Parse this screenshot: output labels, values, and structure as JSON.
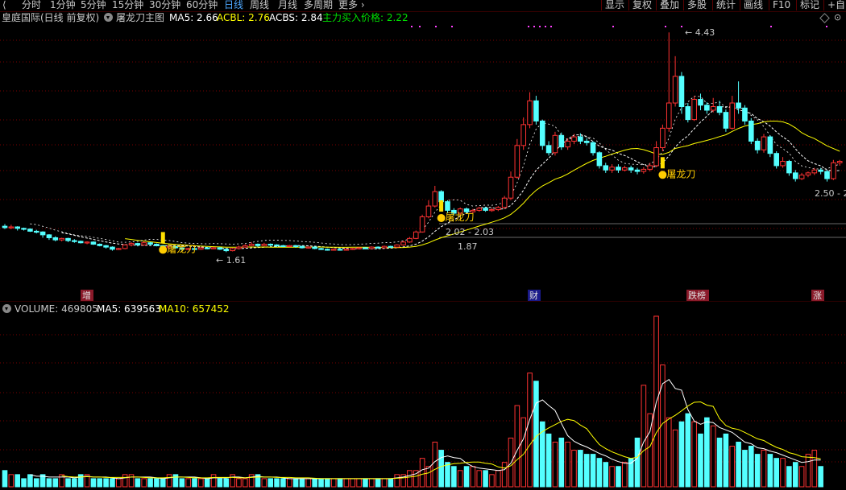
{
  "period_tabs": [
    "分时",
    "1分钟",
    "5分钟",
    "15分钟",
    "30分钟",
    "60分钟",
    "日线",
    "周线",
    "月线",
    "多周期",
    "更多"
  ],
  "active_tab": "日线",
  "right_buttons": [
    "显示",
    "复权",
    "叠加",
    "多股",
    "统计",
    "画线",
    "F10",
    "标记",
    "+自"
  ],
  "stock_title": "皇庭国际(日线 前复权)",
  "indicator_name": "屠龙刀主图",
  "ma5_label": "MA5: 2.66",
  "acbl_label": "ACBL: 2.76",
  "acbs_label": "ACBS: 2.84",
  "buy_price_label": "主力买入价格: 2.22",
  "price_annotations": {
    "high": "4.43",
    "low": "1.61",
    "level1": "2.02 - 2.03",
    "level2": "1.87",
    "right": "2.50 - 2"
  },
  "signal_text": "屠龙刀",
  "events": [
    "增",
    "财",
    "跌榜",
    "涨"
  ],
  "volume_label": "VOLUME: 469805",
  "vol_ma5_label": "MA5: 639563",
  "vol_ma10_label": "MA10: 657452",
  "colors": {
    "up": "#ff3232",
    "down": "#54ffff",
    "ma_white": "#ffffff",
    "ma_yellow": "#ffff00",
    "buy_green": "#00e000",
    "active_tab": "#4ea8ff",
    "grid": "#7a0000",
    "magenta_dots": "#ff40ff"
  },
  "chart_data": {
    "type": "candlestick",
    "price_high": 4.43,
    "price_low": 1.61,
    "candles": [
      [
        1.74,
        1.72,
        1.77,
        1.7
      ],
      [
        1.72,
        1.73,
        1.76,
        1.7
      ],
      [
        1.73,
        1.71,
        1.74,
        1.68
      ],
      [
        1.71,
        1.7,
        1.72,
        1.68
      ],
      [
        1.7,
        1.67,
        1.71,
        1.66
      ],
      [
        1.67,
        1.66,
        1.69,
        1.64
      ],
      [
        1.66,
        1.62,
        1.67,
        1.58
      ],
      [
        1.62,
        1.58,
        1.63,
        1.55
      ],
      [
        1.58,
        1.55,
        1.6,
        1.53
      ],
      [
        1.55,
        1.57,
        1.58,
        1.53
      ],
      [
        1.57,
        1.54,
        1.58,
        1.52
      ],
      [
        1.54,
        1.53,
        1.56,
        1.51
      ],
      [
        1.53,
        1.51,
        1.54,
        1.5
      ],
      [
        1.51,
        1.52,
        1.53,
        1.49
      ],
      [
        1.52,
        1.49,
        1.53,
        1.48
      ],
      [
        1.49,
        1.47,
        1.5,
        1.46
      ],
      [
        1.47,
        1.45,
        1.48,
        1.43
      ],
      [
        1.45,
        1.42,
        1.46,
        1.4
      ],
      [
        1.42,
        1.43,
        1.44,
        1.41
      ],
      [
        1.43,
        1.48,
        1.49,
        1.42
      ],
      [
        1.48,
        1.5,
        1.52,
        1.46
      ],
      [
        1.5,
        1.48,
        1.51,
        1.46
      ],
      [
        1.48,
        1.51,
        1.53,
        1.47
      ],
      [
        1.51,
        1.49,
        1.52,
        1.47
      ],
      [
        1.49,
        1.47,
        1.5,
        1.46
      ],
      [
        1.47,
        1.44,
        1.48,
        1.43
      ],
      [
        1.44,
        1.46,
        1.47,
        1.42
      ],
      [
        1.46,
        1.44,
        1.47,
        1.43
      ],
      [
        1.44,
        1.42,
        1.45,
        1.4
      ],
      [
        1.42,
        1.43,
        1.44,
        1.41
      ],
      [
        1.43,
        1.42,
        1.44,
        1.41
      ],
      [
        1.42,
        1.44,
        1.45,
        1.41
      ],
      [
        1.44,
        1.43,
        1.45,
        1.42
      ],
      [
        1.43,
        1.44,
        1.45,
        1.42
      ],
      [
        1.44,
        1.42,
        1.45,
        1.41
      ],
      [
        1.42,
        1.4,
        1.43,
        1.38
      ],
      [
        1.4,
        1.43,
        1.44,
        1.39
      ],
      [
        1.43,
        1.45,
        1.47,
        1.42
      ],
      [
        1.45,
        1.47,
        1.49,
        1.44
      ],
      [
        1.47,
        1.49,
        1.52,
        1.46
      ],
      [
        1.49,
        1.47,
        1.5,
        1.45
      ],
      [
        1.47,
        1.49,
        1.51,
        1.46
      ],
      [
        1.49,
        1.48,
        1.5,
        1.46
      ],
      [
        1.48,
        1.47,
        1.49,
        1.45
      ],
      [
        1.47,
        1.46,
        1.48,
        1.45
      ],
      [
        1.46,
        1.47,
        1.48,
        1.45
      ],
      [
        1.47,
        1.46,
        1.48,
        1.44
      ],
      [
        1.46,
        1.44,
        1.47,
        1.43
      ],
      [
        1.44,
        1.45,
        1.46,
        1.43
      ],
      [
        1.45,
        1.43,
        1.46,
        1.42
      ],
      [
        1.43,
        1.42,
        1.44,
        1.41
      ],
      [
        1.42,
        1.41,
        1.43,
        1.4
      ],
      [
        1.41,
        1.42,
        1.43,
        1.4
      ],
      [
        1.42,
        1.41,
        1.43,
        1.4
      ],
      [
        1.41,
        1.42,
        1.43,
        1.4
      ],
      [
        1.42,
        1.43,
        1.44,
        1.41
      ],
      [
        1.43,
        1.44,
        1.45,
        1.42
      ],
      [
        1.44,
        1.43,
        1.45,
        1.42
      ],
      [
        1.43,
        1.45,
        1.46,
        1.42
      ],
      [
        1.45,
        1.44,
        1.46,
        1.43
      ],
      [
        1.44,
        1.46,
        1.47,
        1.43
      ],
      [
        1.46,
        1.45,
        1.47,
        1.44
      ],
      [
        1.45,
        1.48,
        1.49,
        1.44
      ],
      [
        1.48,
        1.52,
        1.54,
        1.47
      ],
      [
        1.52,
        1.57,
        1.59,
        1.51
      ],
      [
        1.57,
        1.66,
        1.68,
        1.56
      ],
      [
        1.66,
        1.87,
        1.9,
        1.65
      ],
      [
        1.87,
        2.02,
        2.1,
        1.85
      ],
      [
        2.02,
        2.22,
        2.3,
        2.0
      ],
      [
        2.22,
        2.08,
        2.24,
        2.04
      ],
      [
        2.08,
        1.96,
        2.1,
        1.92
      ],
      [
        1.96,
        1.92,
        1.99,
        1.89
      ],
      [
        1.92,
        1.98,
        2.0,
        1.9
      ],
      [
        1.98,
        1.94,
        2.0,
        1.92
      ],
      [
        1.94,
        1.96,
        1.98,
        1.92
      ],
      [
        1.96,
        1.99,
        2.01,
        1.94
      ],
      [
        1.99,
        1.96,
        2.01,
        1.94
      ],
      [
        1.96,
        1.97,
        1.99,
        1.94
      ],
      [
        1.97,
        2.0,
        2.02,
        1.95
      ],
      [
        2.0,
        2.13,
        2.16,
        1.98
      ],
      [
        2.13,
        2.42,
        2.5,
        2.1
      ],
      [
        2.42,
        2.86,
        2.95,
        2.4
      ],
      [
        2.86,
        3.15,
        3.25,
        2.8
      ],
      [
        3.15,
        3.48,
        3.6,
        3.1
      ],
      [
        3.48,
        3.2,
        3.55,
        3.15
      ],
      [
        3.2,
        2.86,
        3.22,
        2.8
      ],
      [
        2.86,
        2.76,
        2.92,
        2.72
      ],
      [
        2.76,
        3.0,
        3.05,
        2.72
      ],
      [
        3.0,
        2.84,
        3.04,
        2.8
      ],
      [
        2.84,
        2.92,
        2.96,
        2.8
      ],
      [
        2.92,
        2.98,
        3.02,
        2.88
      ],
      [
        2.98,
        2.92,
        3.03,
        2.88
      ],
      [
        2.92,
        2.9,
        2.96,
        2.86
      ],
      [
        2.9,
        2.76,
        2.92,
        2.72
      ],
      [
        2.76,
        2.58,
        2.78,
        2.54
      ],
      [
        2.58,
        2.52,
        2.62,
        2.48
      ],
      [
        2.52,
        2.56,
        2.6,
        2.48
      ],
      [
        2.56,
        2.52,
        2.6,
        2.48
      ],
      [
        2.52,
        2.55,
        2.58,
        2.5
      ],
      [
        2.55,
        2.52,
        2.58,
        2.48
      ],
      [
        2.52,
        2.5,
        2.55,
        2.46
      ],
      [
        2.5,
        2.53,
        2.56,
        2.47
      ],
      [
        2.53,
        2.58,
        2.62,
        2.5
      ],
      [
        2.58,
        2.83,
        2.92,
        2.56
      ],
      [
        2.83,
        3.1,
        3.15,
        2.78
      ],
      [
        3.1,
        3.45,
        4.43,
        3.05
      ],
      [
        3.45,
        3.82,
        4.1,
        3.4
      ],
      [
        3.82,
        3.4,
        3.88,
        3.3
      ],
      [
        3.4,
        3.22,
        3.45,
        3.18
      ],
      [
        3.22,
        3.5,
        3.55,
        3.2
      ],
      [
        3.5,
        3.42,
        3.58,
        3.35
      ],
      [
        3.42,
        3.35,
        3.46,
        3.3
      ],
      [
        3.35,
        3.4,
        3.52,
        3.32
      ],
      [
        3.4,
        3.32,
        3.48,
        3.28
      ],
      [
        3.32,
        3.1,
        3.36,
        3.05
      ],
      [
        3.1,
        3.45,
        3.55,
        3.08
      ],
      [
        3.45,
        3.38,
        3.75,
        3.3
      ],
      [
        3.38,
        3.2,
        3.42,
        3.15
      ],
      [
        3.2,
        2.92,
        3.24,
        2.88
      ],
      [
        2.92,
        2.8,
        2.96,
        2.75
      ],
      [
        2.8,
        2.98,
        3.02,
        2.76
      ],
      [
        2.98,
        2.75,
        3.0,
        2.7
      ],
      [
        2.75,
        2.58,
        2.78,
        2.54
      ],
      [
        2.58,
        2.64,
        2.7,
        2.55
      ],
      [
        2.64,
        2.48,
        2.66,
        2.44
      ],
      [
        2.48,
        2.4,
        2.52,
        2.36
      ],
      [
        2.4,
        2.45,
        2.48,
        2.38
      ],
      [
        2.45,
        2.48,
        2.5,
        2.42
      ],
      [
        2.48,
        2.52,
        2.55,
        2.45
      ],
      [
        2.52,
        2.5,
        2.55,
        2.46
      ],
      [
        2.5,
        2.4,
        2.52,
        2.36
      ],
      [
        2.4,
        2.62,
        2.66,
        2.38
      ],
      [
        2.62,
        2.64,
        2.66,
        2.58
      ]
    ],
    "volume": [
      4,
      3,
      3,
      2,
      3,
      2,
      3,
      2,
      2,
      3,
      2,
      2,
      3,
      3,
      2,
      2,
      2,
      2,
      2,
      3,
      3,
      2,
      2,
      2,
      2,
      2,
      3,
      3,
      2,
      2,
      2,
      2,
      2,
      3,
      2,
      2,
      3,
      2,
      2,
      3,
      3,
      2,
      2,
      2,
      2,
      2,
      2,
      2,
      2,
      2,
      2,
      2,
      2,
      2,
      2,
      2,
      2,
      2,
      2,
      2,
      2,
      2,
      3,
      3,
      4,
      4,
      7,
      5,
      11,
      9,
      6,
      5,
      4,
      5,
      5,
      4,
      4,
      3,
      4,
      6,
      12,
      20,
      17,
      28,
      26,
      16,
      13,
      11,
      12,
      11,
      9,
      9,
      8,
      8,
      7,
      6,
      5,
      5,
      6,
      7,
      12,
      25,
      18,
      42,
      30,
      17,
      14,
      16,
      18,
      16,
      13,
      17,
      15,
      12,
      13,
      10,
      11,
      9,
      10,
      8,
      9,
      8,
      7,
      7,
      5,
      6,
      5,
      8,
      9,
      5
    ]
  }
}
